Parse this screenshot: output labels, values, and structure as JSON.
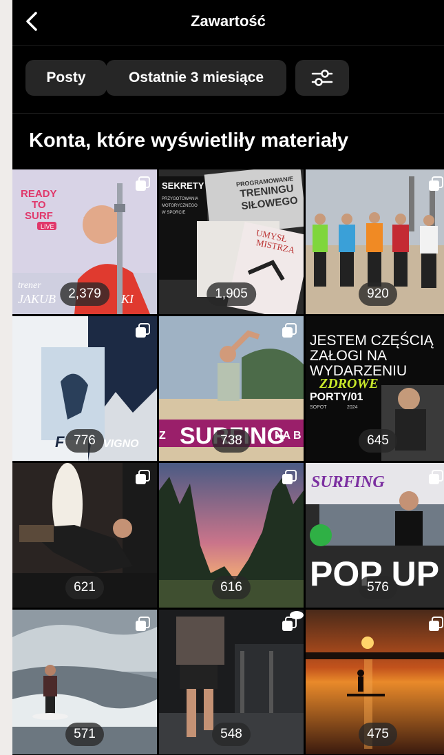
{
  "header": {
    "title": "Zawartość",
    "back_icon": "chevron-left-icon"
  },
  "filters": {
    "type_label": "Posty",
    "range_label": "Ostatnie 3 miesiące",
    "settings_icon": "sliders-icon"
  },
  "section": {
    "title": "Konta, które wyświetliły materiały"
  },
  "posts": [
    {
      "count": "2,379",
      "overlay": [
        "READY",
        "TO",
        "SURF",
        "LIVE",
        "trener",
        "JAKUB",
        "KI"
      ]
    },
    {
      "count": "1,905",
      "overlay": [
        "SEKRETY",
        "PRZYGOTOWANIA",
        "MOTORYCZNEGO",
        "W SPORCIE",
        "PROGRAMOWANIE",
        "TRENINGU",
        "SIŁOWEGO",
        "UMYSŁ",
        "MISTRZA"
      ]
    },
    {
      "count": "920",
      "overlay": []
    },
    {
      "count": "776",
      "overlay": [
        "F",
        "VIGNO"
      ]
    },
    {
      "count": "738",
      "overlay": [
        "SURFING",
        "NA B",
        "Z"
      ]
    },
    {
      "count": "645",
      "overlay": [
        "JESTEM CZĘŚCIĄ",
        "ZAŁOGI NA",
        "WYDARZENIU",
        "ZDROWE",
        "PORTY/01",
        "SOPOT",
        "2024"
      ]
    },
    {
      "count": "621",
      "overlay": []
    },
    {
      "count": "616",
      "overlay": []
    },
    {
      "count": "576",
      "overlay": [
        "SURFING",
        "POP UP"
      ]
    },
    {
      "count": "571",
      "overlay": []
    },
    {
      "count": "548",
      "overlay": []
    },
    {
      "count": "475",
      "overlay": []
    }
  ],
  "colors": {
    "background": "#000000",
    "chip": "#262626",
    "text": "#ffffff"
  }
}
